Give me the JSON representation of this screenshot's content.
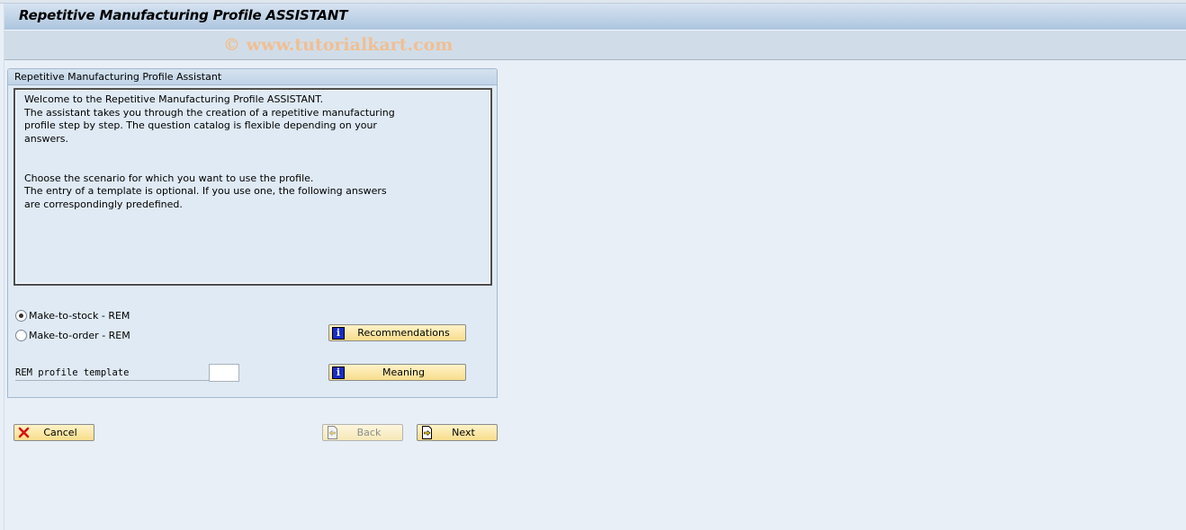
{
  "window": {
    "title": "Repetitive Manufacturing Profile ASSISTANT",
    "watermark": "© www.tutorialkart.com"
  },
  "panel": {
    "header": "Repetitive Manufacturing Profile Assistant",
    "description_lines": [
      "Welcome to the Repetitive Manufacturing Profile ASSISTANT.",
      "The assistant takes you through the creation of a repetitive manufacturing",
      "profile step by step. The question catalog is flexible depending on your",
      "answers.",
      "",
      "",
      "Choose the scenario for which you want to use the profile.",
      "The entry of a template is optional. If you use one, the following answers",
      "are correspondingly predefined."
    ],
    "scenario_options": [
      {
        "label": "Make-to-stock - REM",
        "selected": true
      },
      {
        "label": "Make-to-order - REM",
        "selected": false
      }
    ],
    "template_field": {
      "label": "REM profile template",
      "value": ""
    },
    "buttons": {
      "recommendations": {
        "label": "Recommendations",
        "icon": "info-icon"
      },
      "meaning": {
        "label": "Meaning",
        "icon": "info-icon"
      }
    }
  },
  "footer": {
    "cancel": {
      "label": "Cancel",
      "icon": "cancel-x-icon"
    },
    "back": {
      "label": "Back",
      "icon": "back-page-icon",
      "enabled": false
    },
    "next": {
      "label": "Next",
      "icon": "next-page-icon",
      "enabled": true
    }
  }
}
